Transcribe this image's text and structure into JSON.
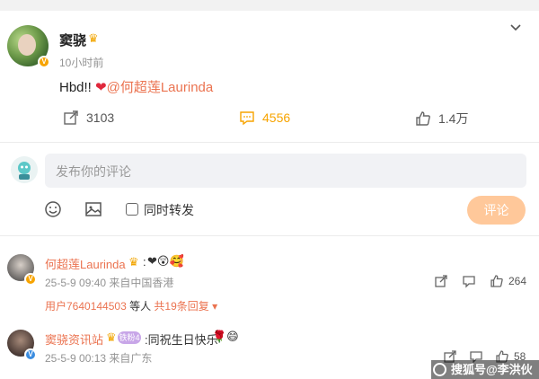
{
  "post": {
    "author": "窦骁",
    "time": "10小时前",
    "text_prefix": "Hbd!! ",
    "heart": "❤",
    "mention": "@何超莲Laurinda",
    "actions": {
      "repost_count": "3103",
      "comment_count": "4556",
      "like_count": "1.4万"
    }
  },
  "composer": {
    "placeholder": "发布你的评论",
    "repost_label": "同时转发",
    "submit_label": "评论"
  },
  "comments": [
    {
      "author": "何超莲Laurinda",
      "text": ":",
      "emojis": "❤😲🥰",
      "meta": "25-5-9 09:40 来自中国香港",
      "like_count": "264",
      "reply_summary": {
        "user": "用户7640144503",
        "middle": " 等人 ",
        "total": "共19条回复"
      }
    },
    {
      "author": "窦骁资讯站",
      "badge": "铁粉4",
      "text": ":同祝生日快乐",
      "emojis": "🌹😄",
      "meta": "25-5-9 00:13 来自广东",
      "like_count": "58"
    }
  ],
  "watermark": "搜狐号@李洪伙",
  "colors": {
    "accent": "#eb7350",
    "vip": "#f7a400",
    "submit_bg": "#ffc89a"
  }
}
